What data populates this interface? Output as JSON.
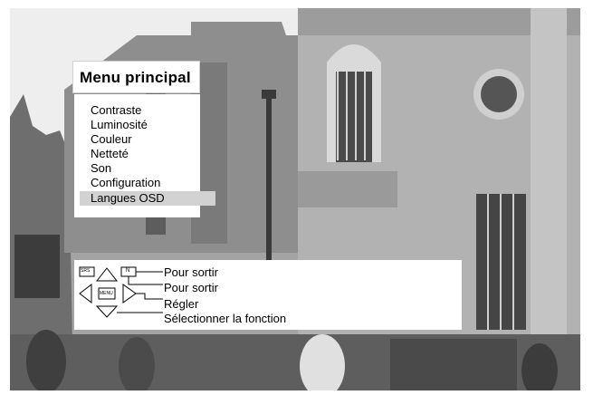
{
  "menu": {
    "title": "Menu principal",
    "items": [
      {
        "label": "Contraste",
        "selected": false
      },
      {
        "label": "Luminosité",
        "selected": false
      },
      {
        "label": "Couleur",
        "selected": false
      },
      {
        "label": "Netteté",
        "selected": false
      },
      {
        "label": "Son",
        "selected": false
      },
      {
        "label": "Configuration",
        "selected": false
      },
      {
        "label": "Langues OSD",
        "selected": true
      }
    ]
  },
  "help": {
    "keys": {
      "exit_key_label": "SRS",
      "n_key_label": "N",
      "menu_key_label": "MENU"
    },
    "lines": [
      "Pour sortir",
      "Pour sortir",
      "Régler",
      "Sélectionner la fonction"
    ]
  },
  "colors": {
    "menu_background": "#ffffff",
    "selected_row": "#d2d2d2",
    "text": "#000000",
    "background_photo": "#9a9a9a"
  }
}
